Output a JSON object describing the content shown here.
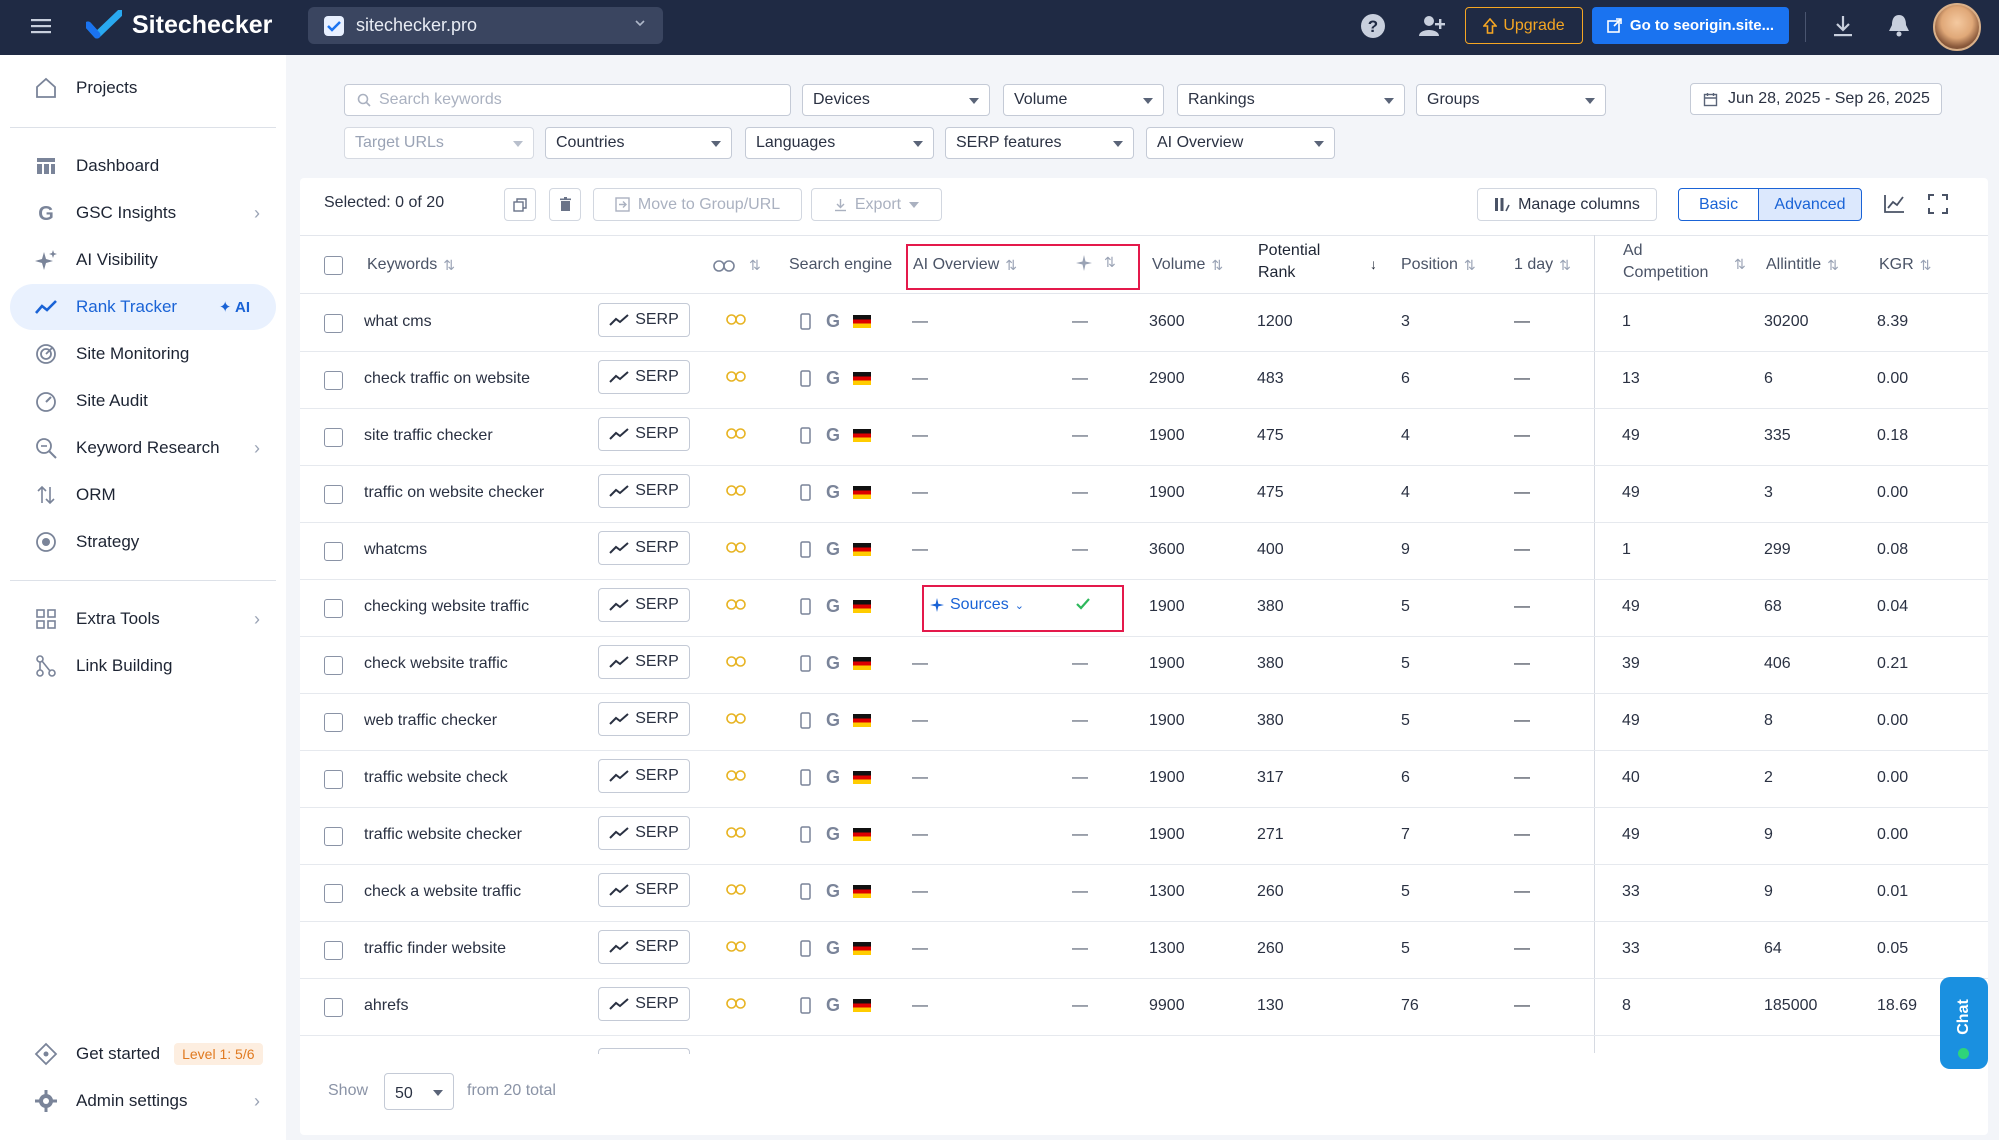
{
  "header": {
    "logo_text": "Sitechecker",
    "project": "sitechecker.pro",
    "upgrade_label": "Upgrade",
    "goto_label": "Go to seorigin.site..."
  },
  "sidebar": {
    "items": [
      {
        "label": "Projects",
        "icon": "home-icon"
      },
      {
        "label": "Dashboard",
        "icon": "dashboard-icon"
      },
      {
        "label": "GSC Insights",
        "icon": "google-icon"
      },
      {
        "label": "AI Visibility",
        "icon": "sparkle-icon"
      },
      {
        "label": "Rank Tracker",
        "icon": "trend-icon",
        "badge": "✦ AI"
      },
      {
        "label": "Site Monitoring",
        "icon": "monitor-icon"
      },
      {
        "label": "Site Audit",
        "icon": "gauge-icon"
      },
      {
        "label": "Keyword Research",
        "icon": "keyword-icon"
      },
      {
        "label": "ORM",
        "icon": "sort-icon"
      },
      {
        "label": "Strategy",
        "icon": "target-icon"
      },
      {
        "label": "Extra Tools",
        "icon": "grid-icon"
      },
      {
        "label": "Link Building",
        "icon": "network-icon"
      },
      {
        "label": "Get started",
        "icon": "diamond-icon",
        "level": "Level 1: 5/6"
      },
      {
        "label": "Admin settings",
        "icon": "gear-icon"
      }
    ]
  },
  "filters": {
    "search_placeholder": "Search keywords",
    "devices": "Devices",
    "volume": "Volume",
    "rankings": "Rankings",
    "groups": "Groups",
    "date_range": "Jun 28, 2025 - Sep 26, 2025",
    "target_urls": "Target URLs",
    "countries": "Countries",
    "languages": "Languages",
    "serp_features": "SERP features",
    "ai_overview": "AI Overview"
  },
  "toolbar": {
    "selected": "Selected: 0 of 20",
    "move_label": "Move to Group/URL",
    "export_label": "Export",
    "manage_columns": "Manage columns",
    "basic": "Basic",
    "advanced": "Advanced"
  },
  "table": {
    "headers": {
      "keywords": "Keywords",
      "search_engine": "Search engine",
      "ai_overview": "AI Overview",
      "volume": "Volume",
      "potential_rank_1": "Potential",
      "potential_rank_2": "Rank",
      "position": "Position",
      "one_day": "1 day",
      "ad_competition_1": "Ad",
      "ad_competition_2": "Competition",
      "allintitle": "Allintitle",
      "kgr": "KGR"
    },
    "serp_label": "SERP",
    "dash": "—",
    "sources_label": "Sources",
    "rows": [
      {
        "keyword": "what cms",
        "ai": "—",
        "ai2": "—",
        "volume": "3600",
        "potential": "1200",
        "position": "3",
        "day": "—",
        "ad": "1",
        "allintitle": "30200",
        "kgr": "8.39"
      },
      {
        "keyword": "check traffic on website",
        "ai": "—",
        "ai2": "—",
        "volume": "2900",
        "potential": "483",
        "position": "6",
        "day": "—",
        "ad": "13",
        "allintitle": "6",
        "kgr": "0.00"
      },
      {
        "keyword": "site traffic checker",
        "ai": "—",
        "ai2": "—",
        "volume": "1900",
        "potential": "475",
        "position": "4",
        "day": "—",
        "ad": "49",
        "allintitle": "335",
        "kgr": "0.18"
      },
      {
        "keyword": "traffic on website checker",
        "ai": "—",
        "ai2": "—",
        "volume": "1900",
        "potential": "475",
        "position": "4",
        "day": "—",
        "ad": "49",
        "allintitle": "3",
        "kgr": "0.00"
      },
      {
        "keyword": "whatcms",
        "ai": "—",
        "ai2": "—",
        "volume": "3600",
        "potential": "400",
        "position": "9",
        "day": "—",
        "ad": "1",
        "allintitle": "299",
        "kgr": "0.08"
      },
      {
        "keyword": "checking website traffic",
        "ai": "sources",
        "ai2": "check",
        "volume": "1900",
        "potential": "380",
        "position": "5",
        "day": "—",
        "ad": "49",
        "allintitle": "68",
        "kgr": "0.04"
      },
      {
        "keyword": "check website traffic",
        "ai": "—",
        "ai2": "—",
        "volume": "1900",
        "potential": "380",
        "position": "5",
        "day": "—",
        "ad": "39",
        "allintitle": "406",
        "kgr": "0.21"
      },
      {
        "keyword": "web traffic checker",
        "ai": "—",
        "ai2": "—",
        "volume": "1900",
        "potential": "380",
        "position": "5",
        "day": "—",
        "ad": "49",
        "allintitle": "8",
        "kgr": "0.00"
      },
      {
        "keyword": "traffic website check",
        "ai": "—",
        "ai2": "—",
        "volume": "1900",
        "potential": "317",
        "position": "6",
        "day": "—",
        "ad": "40",
        "allintitle": "2",
        "kgr": "0.00"
      },
      {
        "keyword": "traffic website checker",
        "ai": "—",
        "ai2": "—",
        "volume": "1900",
        "potential": "271",
        "position": "7",
        "day": "—",
        "ad": "49",
        "allintitle": "9",
        "kgr": "0.00"
      },
      {
        "keyword": "check a website traffic",
        "ai": "—",
        "ai2": "—",
        "volume": "1300",
        "potential": "260",
        "position": "5",
        "day": "—",
        "ad": "33",
        "allintitle": "9",
        "kgr": "0.01"
      },
      {
        "keyword": "traffic finder website",
        "ai": "—",
        "ai2": "—",
        "volume": "1300",
        "potential": "260",
        "position": "5",
        "day": "—",
        "ad": "33",
        "allintitle": "64",
        "kgr": "0.05"
      },
      {
        "keyword": "ahrefs",
        "ai": "—",
        "ai2": "—",
        "volume": "9900",
        "potential": "130",
        "position": "76",
        "day": "—",
        "ad": "8",
        "allintitle": "185000",
        "kgr": "18.69"
      }
    ]
  },
  "footer": {
    "show_label": "Show",
    "page_size": "50",
    "total": "from 20 total"
  },
  "chat_label": "Chat",
  "colors": {
    "topbar": "#1f2a44",
    "accent": "#1a63d6",
    "upgrade": "#f5a623",
    "highlight": "#e4194b"
  }
}
